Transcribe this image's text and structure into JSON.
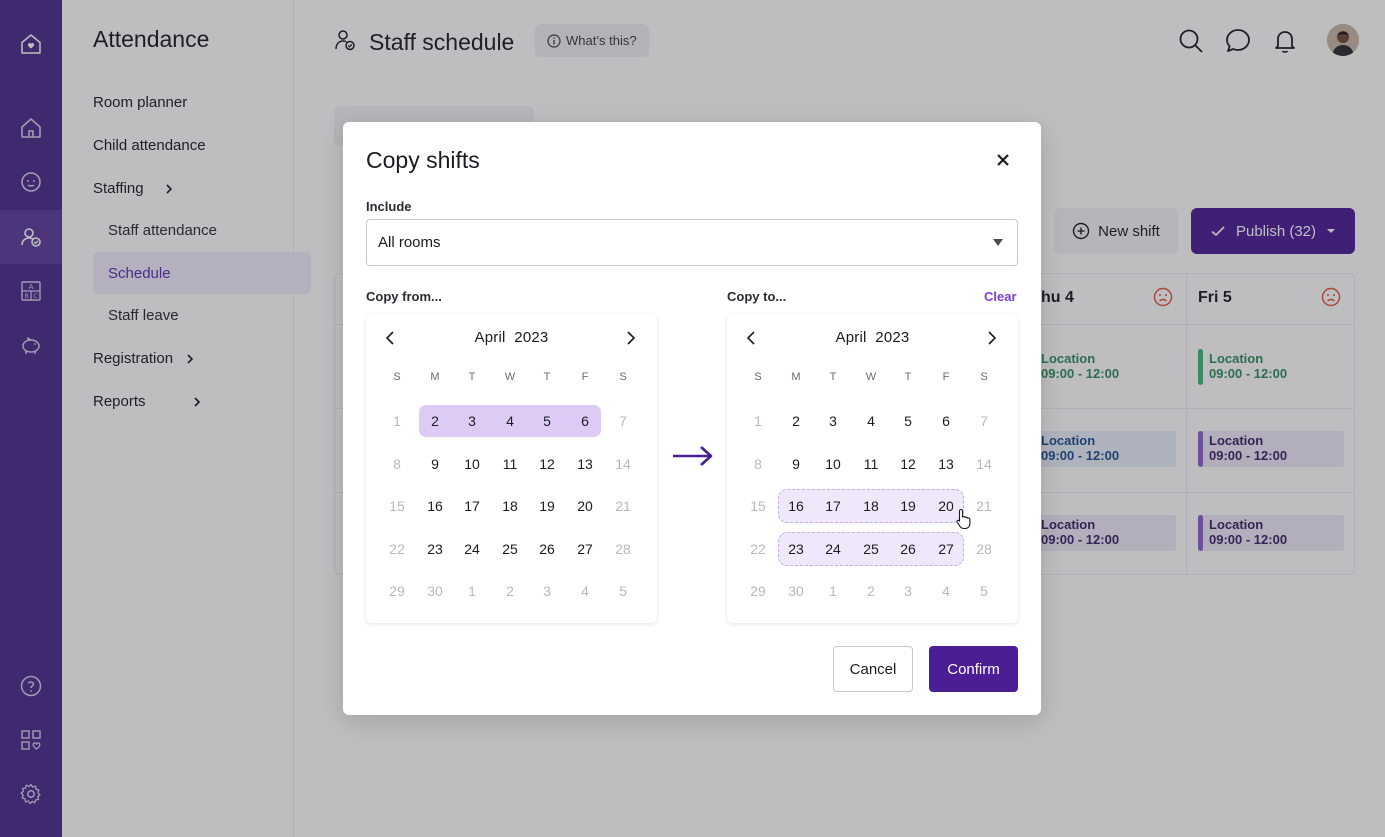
{
  "sidebar": {
    "title": "Attendance",
    "items": [
      {
        "label": "Room planner"
      },
      {
        "label": "Child attendance"
      },
      {
        "label": "Staffing"
      },
      {
        "label": "Staff attendance"
      },
      {
        "label": "Schedule"
      },
      {
        "label": "Staff leave"
      },
      {
        "label": "Registration"
      },
      {
        "label": "Reports"
      }
    ]
  },
  "header": {
    "title": "Staff schedule",
    "whats_this": "What’s this?"
  },
  "toolbar": {
    "new_shift": "New shift",
    "publish": "Publish (32)"
  },
  "schedule": {
    "columns": [
      "hu 4",
      "Fri 5"
    ],
    "shifts": [
      {
        "location": "Location",
        "time": "09:00 - 12:00"
      }
    ]
  },
  "modal": {
    "title": "Copy shifts",
    "include_label": "Include",
    "include_value": "All rooms",
    "copy_from_label": "Copy from...",
    "copy_to_label": "Copy to...",
    "clear_label": "Clear",
    "cancel_label": "Cancel",
    "confirm_label": "Confirm",
    "from_calendar": {
      "month": "April",
      "year": "2023"
    },
    "to_calendar": {
      "month": "April",
      "year": "2023"
    },
    "weekdays": [
      "S",
      "M",
      "T",
      "W",
      "T",
      "F",
      "S"
    ],
    "weeks": [
      [
        "1",
        "2",
        "3",
        "4",
        "5",
        "6",
        "7"
      ],
      [
        "8",
        "9",
        "10",
        "11",
        "12",
        "13",
        "14"
      ],
      [
        "15",
        "16",
        "17",
        "18",
        "19",
        "20",
        "21"
      ],
      [
        "22",
        "23",
        "24",
        "25",
        "26",
        "27",
        "28"
      ],
      [
        "29",
        "30",
        "1",
        "2",
        "3",
        "4",
        "5"
      ]
    ]
  },
  "colors": {
    "accent": "#4b1e96",
    "rail": "#4b2a8a",
    "selection": "#ddcbf6"
  }
}
